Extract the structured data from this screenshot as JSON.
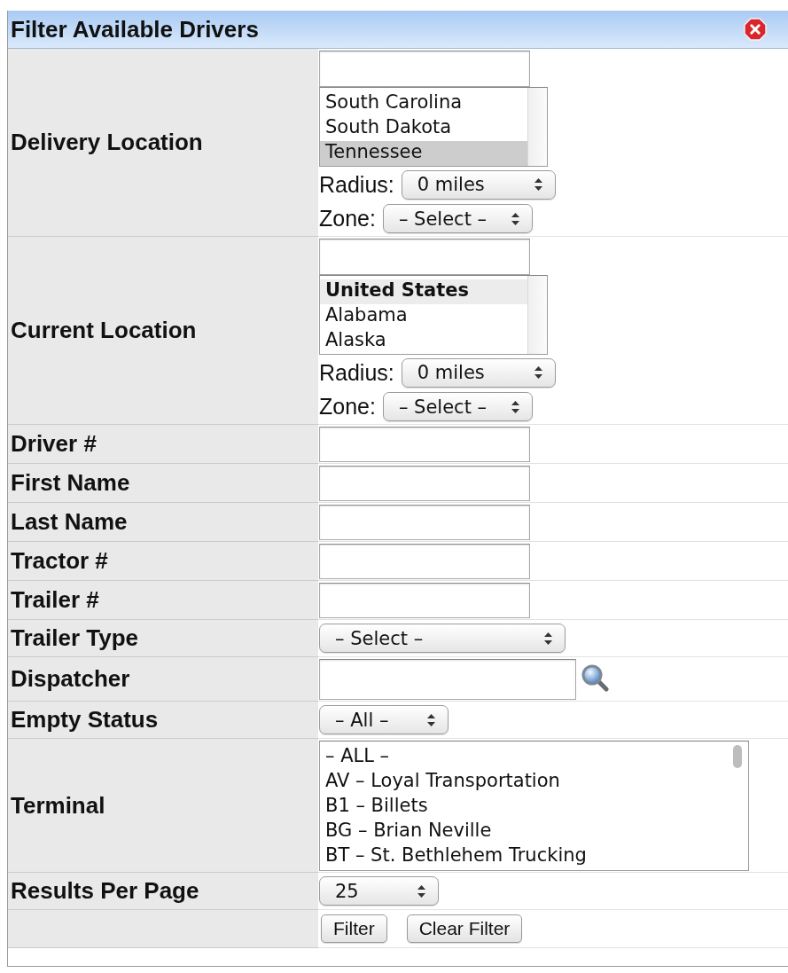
{
  "dialog": {
    "title": "Filter Available Drivers"
  },
  "fields": [
    {
      "kind": "location",
      "label": "Delivery Location",
      "options": [
        {
          "text": "South Carolina",
          "kind": "option",
          "selected": false
        },
        {
          "text": "South Dakota",
          "kind": "option",
          "selected": false
        },
        {
          "text": "Tennessee",
          "kind": "option",
          "selected": true
        }
      ],
      "radius": {
        "label": "Radius:",
        "value": "0 miles"
      },
      "zone": {
        "label": "Zone:",
        "value": "– Select –"
      }
    },
    {
      "kind": "location",
      "label": "Current Location",
      "options": [
        {
          "text": "United States",
          "kind": "group",
          "selected": false
        },
        {
          "text": "Alabama",
          "kind": "option",
          "selected": false
        },
        {
          "text": "Alaska",
          "kind": "option",
          "selected": false
        }
      ],
      "radius": {
        "label": "Radius:",
        "value": "0 miles"
      },
      "zone": {
        "label": "Zone:",
        "value": "– Select –"
      }
    },
    {
      "kind": "text",
      "label": "Driver #"
    },
    {
      "kind": "text",
      "label": "First Name"
    },
    {
      "kind": "text",
      "label": "Last Name"
    },
    {
      "kind": "text",
      "label": "Tractor #"
    },
    {
      "kind": "text",
      "label": "Trailer #"
    },
    {
      "kind": "select",
      "label": "Trailer Type",
      "value": "– Select –"
    },
    {
      "kind": "lookup",
      "label": "Dispatcher"
    },
    {
      "kind": "select",
      "label": "Empty Status",
      "value": "– All –"
    },
    {
      "kind": "listbox",
      "label": "Terminal",
      "options": [
        {
          "text": "– ALL –",
          "kind": "option",
          "selected": false
        },
        {
          "text": "AV – Loyal Transportation",
          "kind": "option",
          "selected": false
        },
        {
          "text": "B1 – Billets",
          "kind": "option",
          "selected": false
        },
        {
          "text": "BG – Brian Neville",
          "kind": "option",
          "selected": false
        },
        {
          "text": "BT – St. Bethlehem Trucking",
          "kind": "option",
          "selected": false
        }
      ]
    },
    {
      "kind": "select",
      "label": "Results Per Page",
      "value": "25"
    }
  ],
  "buttons": [
    {
      "label": "Filter"
    },
    {
      "label": "Clear Filter"
    }
  ]
}
